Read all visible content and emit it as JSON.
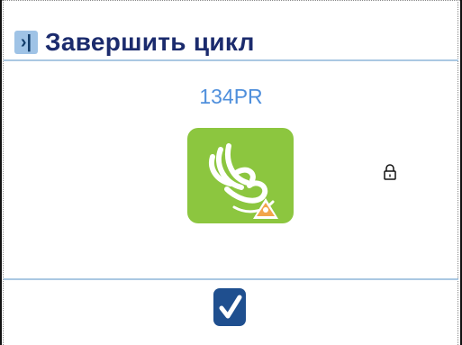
{
  "header": {
    "icon": "skip-forward-icon",
    "title": "Завершить цикл"
  },
  "cycle": {
    "code": "134PR",
    "tile_color": "#8cc63f",
    "tile_icon": "hand-with-water-warning-icon"
  },
  "status": {
    "lock_icon": "lock-icon"
  },
  "actions": {
    "confirm_icon": "check-icon",
    "confirm_color": "#1f4f8f"
  }
}
